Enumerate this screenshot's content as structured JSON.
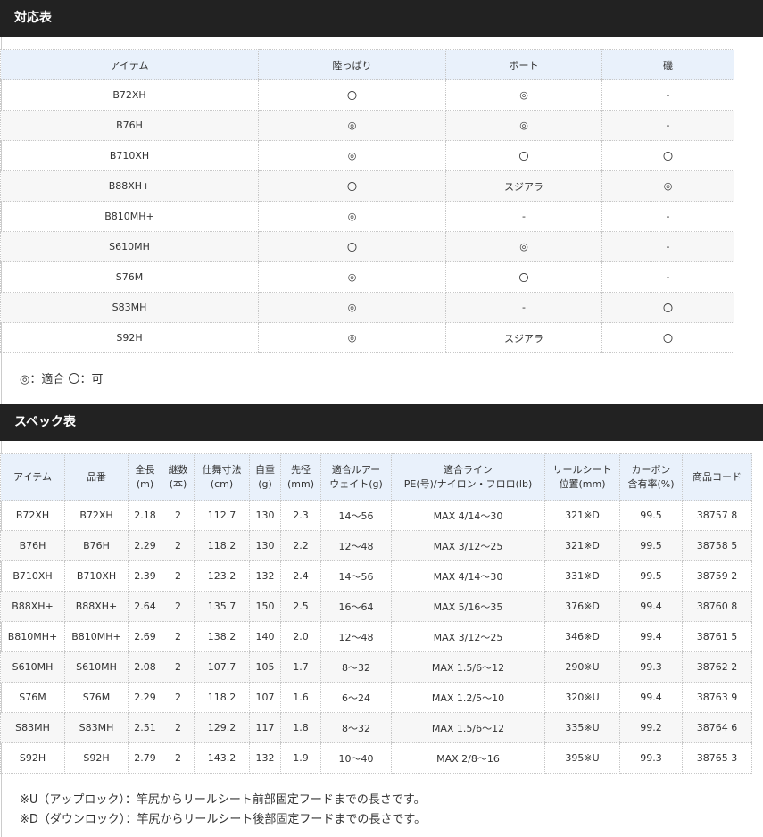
{
  "compat": {
    "title": "対応表",
    "headers": [
      "アイテム",
      "陸っぱり",
      "ボート",
      "磯"
    ],
    "rows": [
      [
        "B72XH",
        "〇",
        "◎",
        "-"
      ],
      [
        "B76H",
        "◎",
        "◎",
        "-"
      ],
      [
        "B710XH",
        "◎",
        "〇",
        "〇"
      ],
      [
        "B88XH+",
        "〇",
        "スジアラ",
        "◎"
      ],
      [
        "B810MH+",
        "◎",
        "-",
        "-"
      ],
      [
        "S610MH",
        "〇",
        "◎",
        "-"
      ],
      [
        "S76M",
        "◎",
        "〇",
        "-"
      ],
      [
        "S83MH",
        "◎",
        "-",
        "〇"
      ],
      [
        "S92H",
        "◎",
        "スジアラ",
        "〇"
      ]
    ],
    "legend": "◎：適合 〇：可"
  },
  "spec": {
    "title": "スペック表",
    "headers": [
      [
        "アイテム"
      ],
      [
        "品番"
      ],
      [
        "全長",
        "(m)"
      ],
      [
        "継数",
        "(本)"
      ],
      [
        "仕舞寸法",
        "(cm)"
      ],
      [
        "自重",
        "(g)"
      ],
      [
        "先径",
        "(mm)"
      ],
      [
        "適合ルアー",
        "ウェイト(g)"
      ],
      [
        "適合ライン",
        "PE(号)/ナイロン・フロロ(lb)"
      ],
      [
        "リールシート",
        "位置(mm)"
      ],
      [
        "カーボン",
        "含有率(%)"
      ],
      [
        "商品コード"
      ]
    ],
    "rows": [
      [
        "B72XH",
        "B72XH",
        "2.18",
        "2",
        "112.7",
        "130",
        "2.3",
        "14～56",
        "MAX 4/14～30",
        "321※D",
        "99.5",
        "38757 8"
      ],
      [
        "B76H",
        "B76H",
        "2.29",
        "2",
        "118.2",
        "130",
        "2.2",
        "12～48",
        "MAX 3/12～25",
        "321※D",
        "99.5",
        "38758 5"
      ],
      [
        "B710XH",
        "B710XH",
        "2.39",
        "2",
        "123.2",
        "132",
        "2.4",
        "14～56",
        "MAX 4/14～30",
        "331※D",
        "99.5",
        "38759 2"
      ],
      [
        "B88XH+",
        "B88XH+",
        "2.64",
        "2",
        "135.7",
        "150",
        "2.5",
        "16～64",
        "MAX 5/16～35",
        "376※D",
        "99.4",
        "38760 8"
      ],
      [
        "B810MH+",
        "B810MH+",
        "2.69",
        "2",
        "138.2",
        "140",
        "2.0",
        "12～48",
        "MAX 3/12～25",
        "346※D",
        "99.4",
        "38761 5"
      ],
      [
        "S610MH",
        "S610MH",
        "2.08",
        "2",
        "107.7",
        "105",
        "1.7",
        "8～32",
        "MAX 1.5/6～12",
        "290※U",
        "99.3",
        "38762 2"
      ],
      [
        "S76M",
        "S76M",
        "2.29",
        "2",
        "118.2",
        "107",
        "1.6",
        "6～24",
        "MAX 1.2/5～10",
        "320※U",
        "99.4",
        "38763 9"
      ],
      [
        "S83MH",
        "S83MH",
        "2.51",
        "2",
        "129.2",
        "117",
        "1.8",
        "8～32",
        "MAX 1.5/6～12",
        "335※U",
        "99.2",
        "38764 6"
      ],
      [
        "S92H",
        "S92H",
        "2.79",
        "2",
        "143.2",
        "132",
        "1.9",
        "10～40",
        "MAX 2/8～16",
        "395※U",
        "99.3",
        "38765 3"
      ]
    ],
    "notes": [
      "※U（アップロック）：竿尻からリールシート前部固定フードまでの長さです。",
      "※D（ダウンロック）：竿尻からリールシート後部固定フードまでの長さです。"
    ]
  }
}
